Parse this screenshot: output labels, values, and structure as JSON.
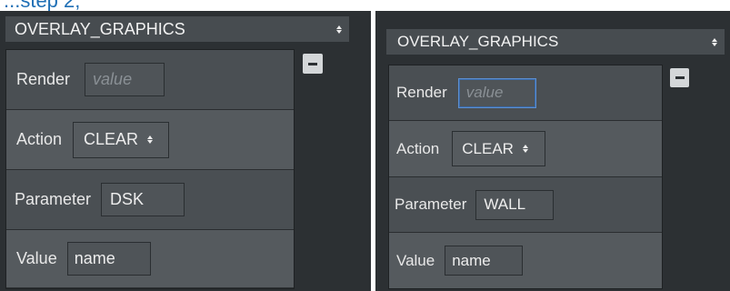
{
  "caption": "...step 2;",
  "panels": [
    {
      "select_value": "OVERLAY_GRAPHICS",
      "rows": {
        "render": {
          "label": "Render",
          "placeholder": "value"
        },
        "action": {
          "label": "Action",
          "value": "CLEAR"
        },
        "parameter": {
          "label": "Parameter",
          "value": "DSK"
        },
        "value": {
          "label": "Value",
          "value": "name"
        }
      }
    },
    {
      "select_value": "OVERLAY_GRAPHICS",
      "rows": {
        "render": {
          "label": "Render",
          "placeholder": "value"
        },
        "action": {
          "label": "Action",
          "value": "CLEAR"
        },
        "parameter": {
          "label": "Parameter",
          "value": "WALL"
        },
        "value": {
          "label": "Value",
          "value": "name"
        }
      }
    }
  ],
  "icons": {
    "remove": "minus-icon",
    "select": "select-arrows-icon"
  },
  "colors": {
    "caption": "#1f6fb5",
    "panel_bg": "#2c3033",
    "focus": "#5d8fd0"
  }
}
